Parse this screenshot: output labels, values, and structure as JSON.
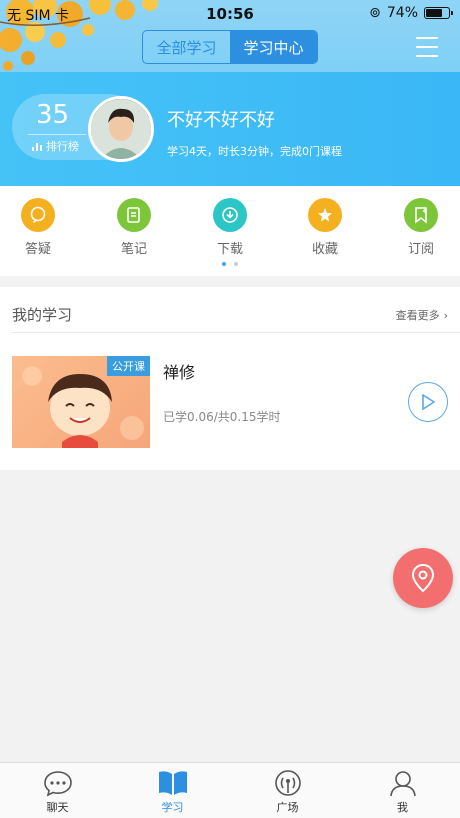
{
  "status_bar": {
    "carrier": "无 SIM 卡",
    "time": "10:56",
    "battery": "74%",
    "battery_level": 0.74
  },
  "header": {
    "tabs": [
      {
        "label": "全部学习",
        "active": false
      },
      {
        "label": "学习中心",
        "active": true
      }
    ],
    "menu_icon": "hamburger-menu-icon"
  },
  "profile": {
    "rank_number": "35",
    "rank_label": "排行榜",
    "username": "不好不好不好",
    "stats": "学习4天，时长3分钟，完成0门课程"
  },
  "quick_actions": [
    {
      "label": "答疑",
      "icon": "chat-bubble-icon",
      "color": "#f5b020"
    },
    {
      "label": "笔记",
      "icon": "note-icon",
      "color": "#7dc63a"
    },
    {
      "label": "下载",
      "icon": "download-icon",
      "color": "#2dc6c6"
    },
    {
      "label": "收藏",
      "icon": "star-icon",
      "color": "#f5b020"
    },
    {
      "label": "订阅",
      "icon": "bookmark-icon",
      "color": "#7dc63a"
    }
  ],
  "my_learning": {
    "title": "我的学习",
    "more": "查看更多",
    "course": {
      "badge": "公开课",
      "title": "禅修",
      "progress": "已学0.06/共0.15学时"
    }
  },
  "tabbar": [
    {
      "label": "聊天",
      "icon": "chat-icon",
      "active": false
    },
    {
      "label": "学习",
      "icon": "book-icon",
      "active": true
    },
    {
      "label": "广场",
      "icon": "broadcast-icon",
      "active": false
    },
    {
      "label": "我",
      "icon": "person-icon",
      "active": false
    }
  ],
  "colors": {
    "primary": "#2d8fe0",
    "banner": "#3ab7f6",
    "fab": "#f36f6f"
  }
}
